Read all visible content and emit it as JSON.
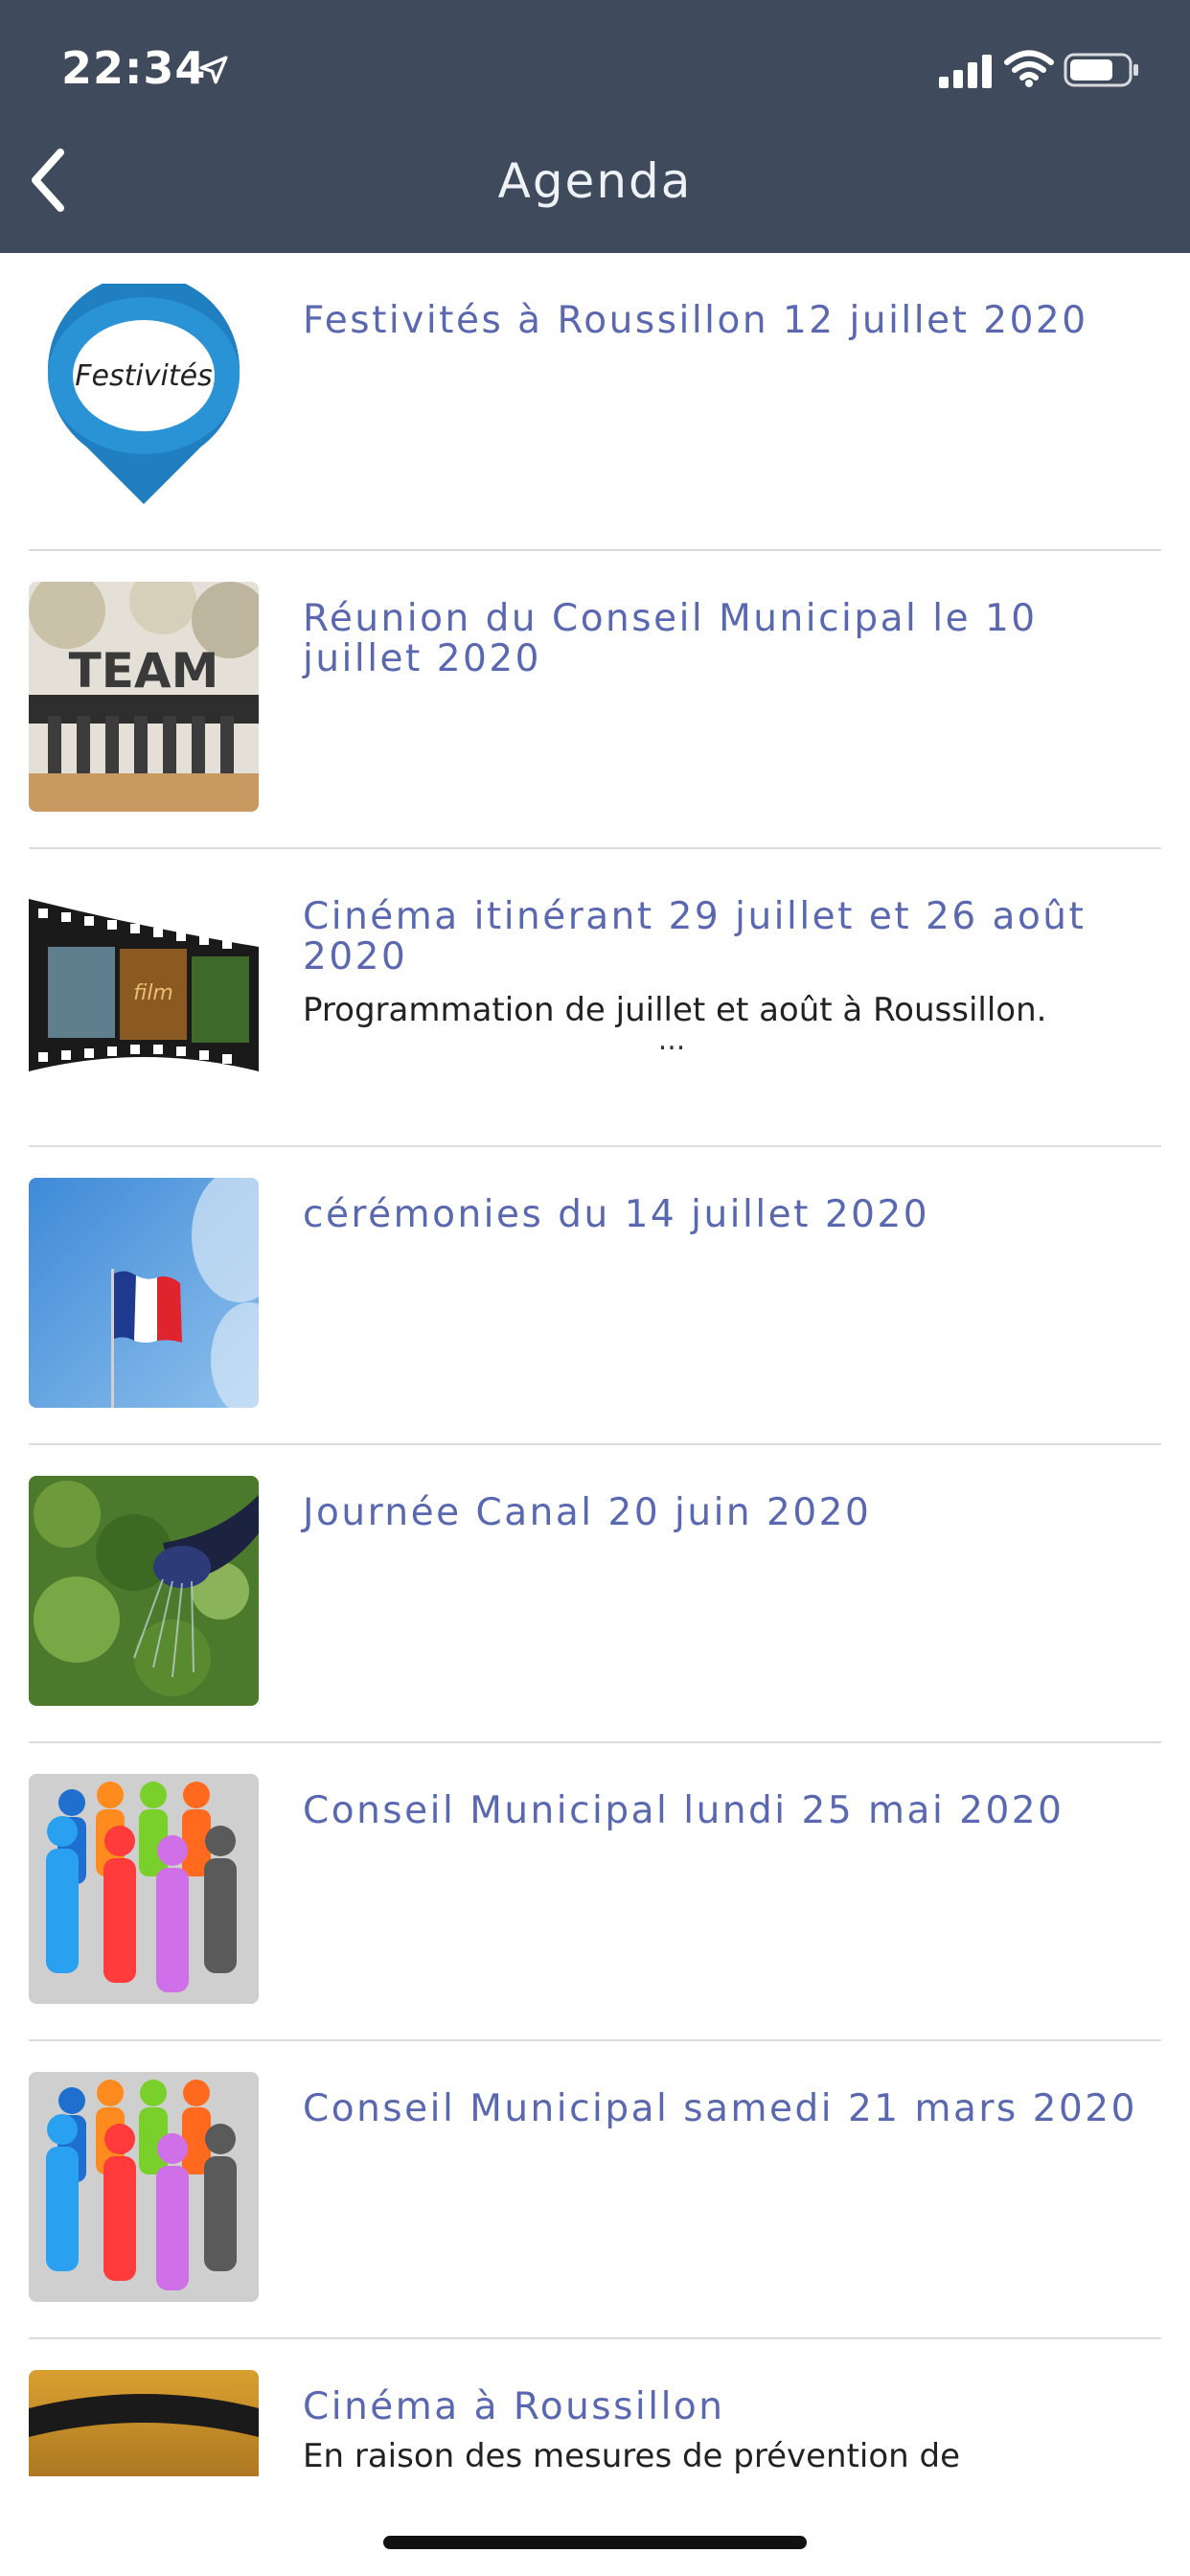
{
  "status_bar": {
    "time": "22:34"
  },
  "header": {
    "title": "Agenda"
  },
  "items": [
    {
      "title": "Festivités à Roussillon 12 juillet 2020",
      "subtitle": "",
      "ellipsis": "",
      "thumb_text": "Festivités"
    },
    {
      "title": "Réunion du Conseil Municipal le 10 juillet 2020",
      "subtitle": "",
      "ellipsis": "",
      "thumb_text": "TEAM"
    },
    {
      "title": "Cinéma itinérant 29 juillet et 26 août 2020",
      "subtitle": "Programmation de juillet et août à Roussillon.",
      "ellipsis": "...",
      "thumb_text": "film"
    },
    {
      "title": "cérémonies du 14 juillet 2020",
      "subtitle": "",
      "ellipsis": "",
      "thumb_text": ""
    },
    {
      "title": "Journée Canal 20 juin 2020",
      "subtitle": "",
      "ellipsis": "",
      "thumb_text": ""
    },
    {
      "title": "Conseil Municipal lundi 25 mai 2020",
      "subtitle": "",
      "ellipsis": "",
      "thumb_text": ""
    },
    {
      "title": "Conseil Municipal samedi 21 mars 2020",
      "subtitle": "",
      "ellipsis": "",
      "thumb_text": ""
    },
    {
      "title": "Cinéma à Roussillon",
      "subtitle": "En raison des mesures de prévention de",
      "ellipsis": "",
      "thumb_text": ""
    }
  ],
  "colors": {
    "header_bg": "#3f4b5c",
    "title_text": "#5968b0"
  }
}
